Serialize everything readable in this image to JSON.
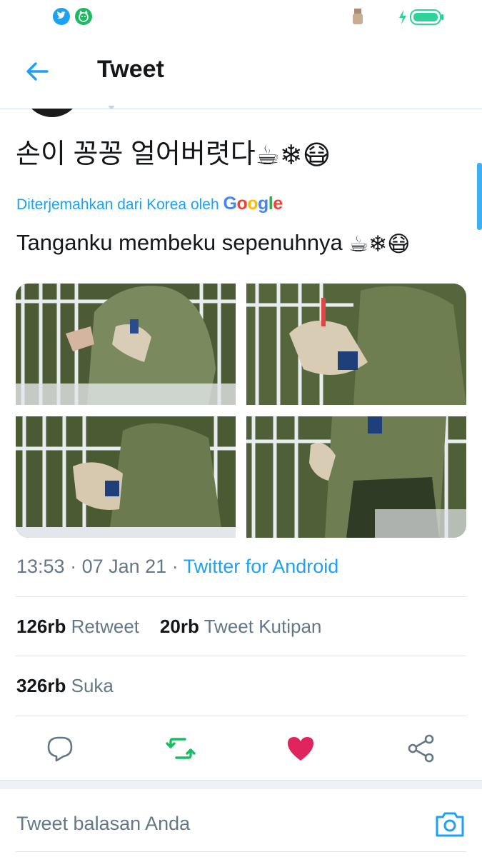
{
  "statusbar": {
    "icons": [
      "twitter-icon",
      "notification-app-icon",
      "usb-icon",
      "charging-bolt-icon",
      "battery-icon"
    ]
  },
  "header": {
    "title": "Tweet",
    "back_icon": "arrow-left-icon"
  },
  "tweet": {
    "text": "손이 꽁꽁 얼어버렷다",
    "text_emojis": "☕❄😷",
    "translated_label": "Diterjemahkan dari Korea oleh",
    "translated_brand": "Google",
    "translation": "Tanganku membeku sepenuhnya",
    "translation_emojis": "☕❄😷",
    "media": [
      {
        "alt": "photo-1"
      },
      {
        "alt": "photo-2"
      },
      {
        "alt": "photo-3"
      },
      {
        "alt": "photo-4"
      }
    ],
    "time": "13:53",
    "date": "07 Jan 21",
    "source": "Twitter for Android"
  },
  "stats": {
    "retweets_count": "126rb",
    "retweets_label": "Retweet",
    "quotes_count": "20rb",
    "quotes_label": "Tweet Kutipan",
    "likes_count": "326rb",
    "likes_label": "Suka"
  },
  "actions": {
    "reply_icon": "reply-bubble-icon",
    "retweet_icon": "retweet-icon",
    "like_icon": "heart-icon",
    "share_icon": "share-icon"
  },
  "reply": {
    "placeholder": "Tweet balasan Anda",
    "camera_icon": "camera-icon"
  },
  "colors": {
    "accent": "#1da1f2",
    "retweet_green": "#17bf63",
    "like_red": "#e0245e",
    "text_secondary": "#657786"
  }
}
